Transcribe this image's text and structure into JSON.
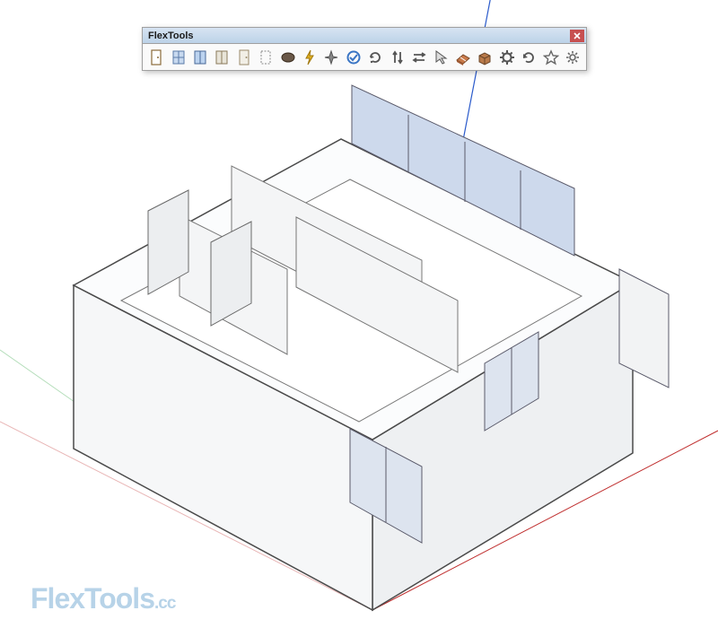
{
  "toolbar": {
    "title": "FlexTools",
    "close_label": "Close",
    "tools": [
      {
        "name": "flex-door-basic-icon"
      },
      {
        "name": "flex-window-icon"
      },
      {
        "name": "flex-window-glass-icon"
      },
      {
        "name": "flex-double-door-icon"
      },
      {
        "name": "flex-door-icon"
      },
      {
        "name": "flex-hole-icon"
      },
      {
        "name": "flex-solid-component-icon"
      },
      {
        "name": "zap-icon"
      },
      {
        "name": "sparkle-icon"
      },
      {
        "name": "convert-icon"
      },
      {
        "name": "reload-icon"
      },
      {
        "name": "swap-vertical-icon"
      },
      {
        "name": "swap-horizontal-icon"
      },
      {
        "name": "arrow-select-icon"
      },
      {
        "name": "wall-cut-icon"
      },
      {
        "name": "package-icon"
      },
      {
        "name": "gear-icon"
      },
      {
        "name": "refresh-icon"
      },
      {
        "name": "star-favorite-icon"
      },
      {
        "name": "settings-icon"
      }
    ]
  },
  "watermark": {
    "brand_bold": "Flex",
    "brand_rest": "Tools",
    "tld": ".cc"
  }
}
